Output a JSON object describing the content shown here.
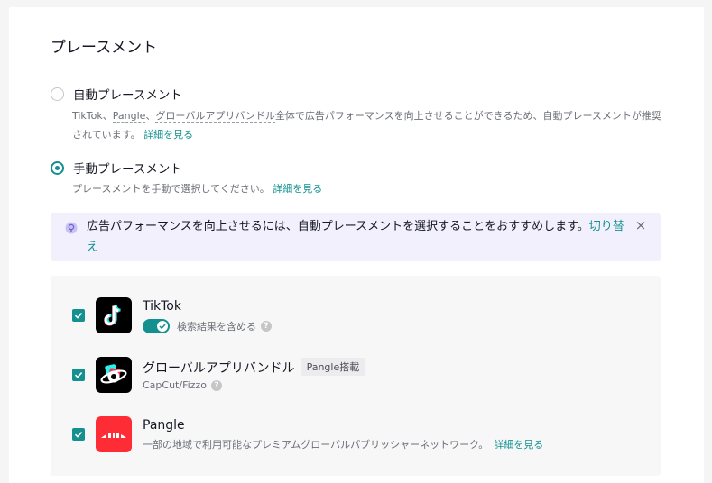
{
  "page": {
    "title": "プレースメント"
  },
  "auto": {
    "label": "自動プレースメント",
    "desc_tiktok": "TikTok",
    "desc_sep1": "、",
    "desc_pangle": "Pangle",
    "desc_sep2": "、",
    "desc_global": "グローバルアプリバンドル",
    "desc_rest": "全体で広告パフォーマンスを向上させることができるため、自動プレースメントが推奨されています。",
    "link": "詳細を見る"
  },
  "manual": {
    "label": "手動プレースメント",
    "desc": "プレースメントを手動で選択してください。",
    "link": "詳細を見る"
  },
  "alert": {
    "text": "広告パフォーマンスを向上させるには、自動プレースメントを選択することをおすすめします。",
    "link": "切り替え",
    "close_glyph": "×"
  },
  "placements": [
    {
      "name": "TikTok",
      "sub": "検索結果を含める",
      "icon": "tiktok-logo-icon"
    },
    {
      "name": "グローバルアプリバンドル",
      "badge": "Pangle搭載",
      "sub": "CapCut/Fizzo",
      "icon": "global-app-bundle-icon"
    },
    {
      "name": "Pangle",
      "sub": "一部の地域で利用可能なプレミアムグローバルパブリッシャーネットワーク。",
      "link": "詳細を見る",
      "icon": "pangle-logo-icon"
    }
  ],
  "help_glyph": "?",
  "colors": {
    "accent": "#13908f",
    "alert_bg": "#f1f0fc",
    "panel_bg": "#f7f7f8",
    "pangle_red": "#fe2c35"
  }
}
